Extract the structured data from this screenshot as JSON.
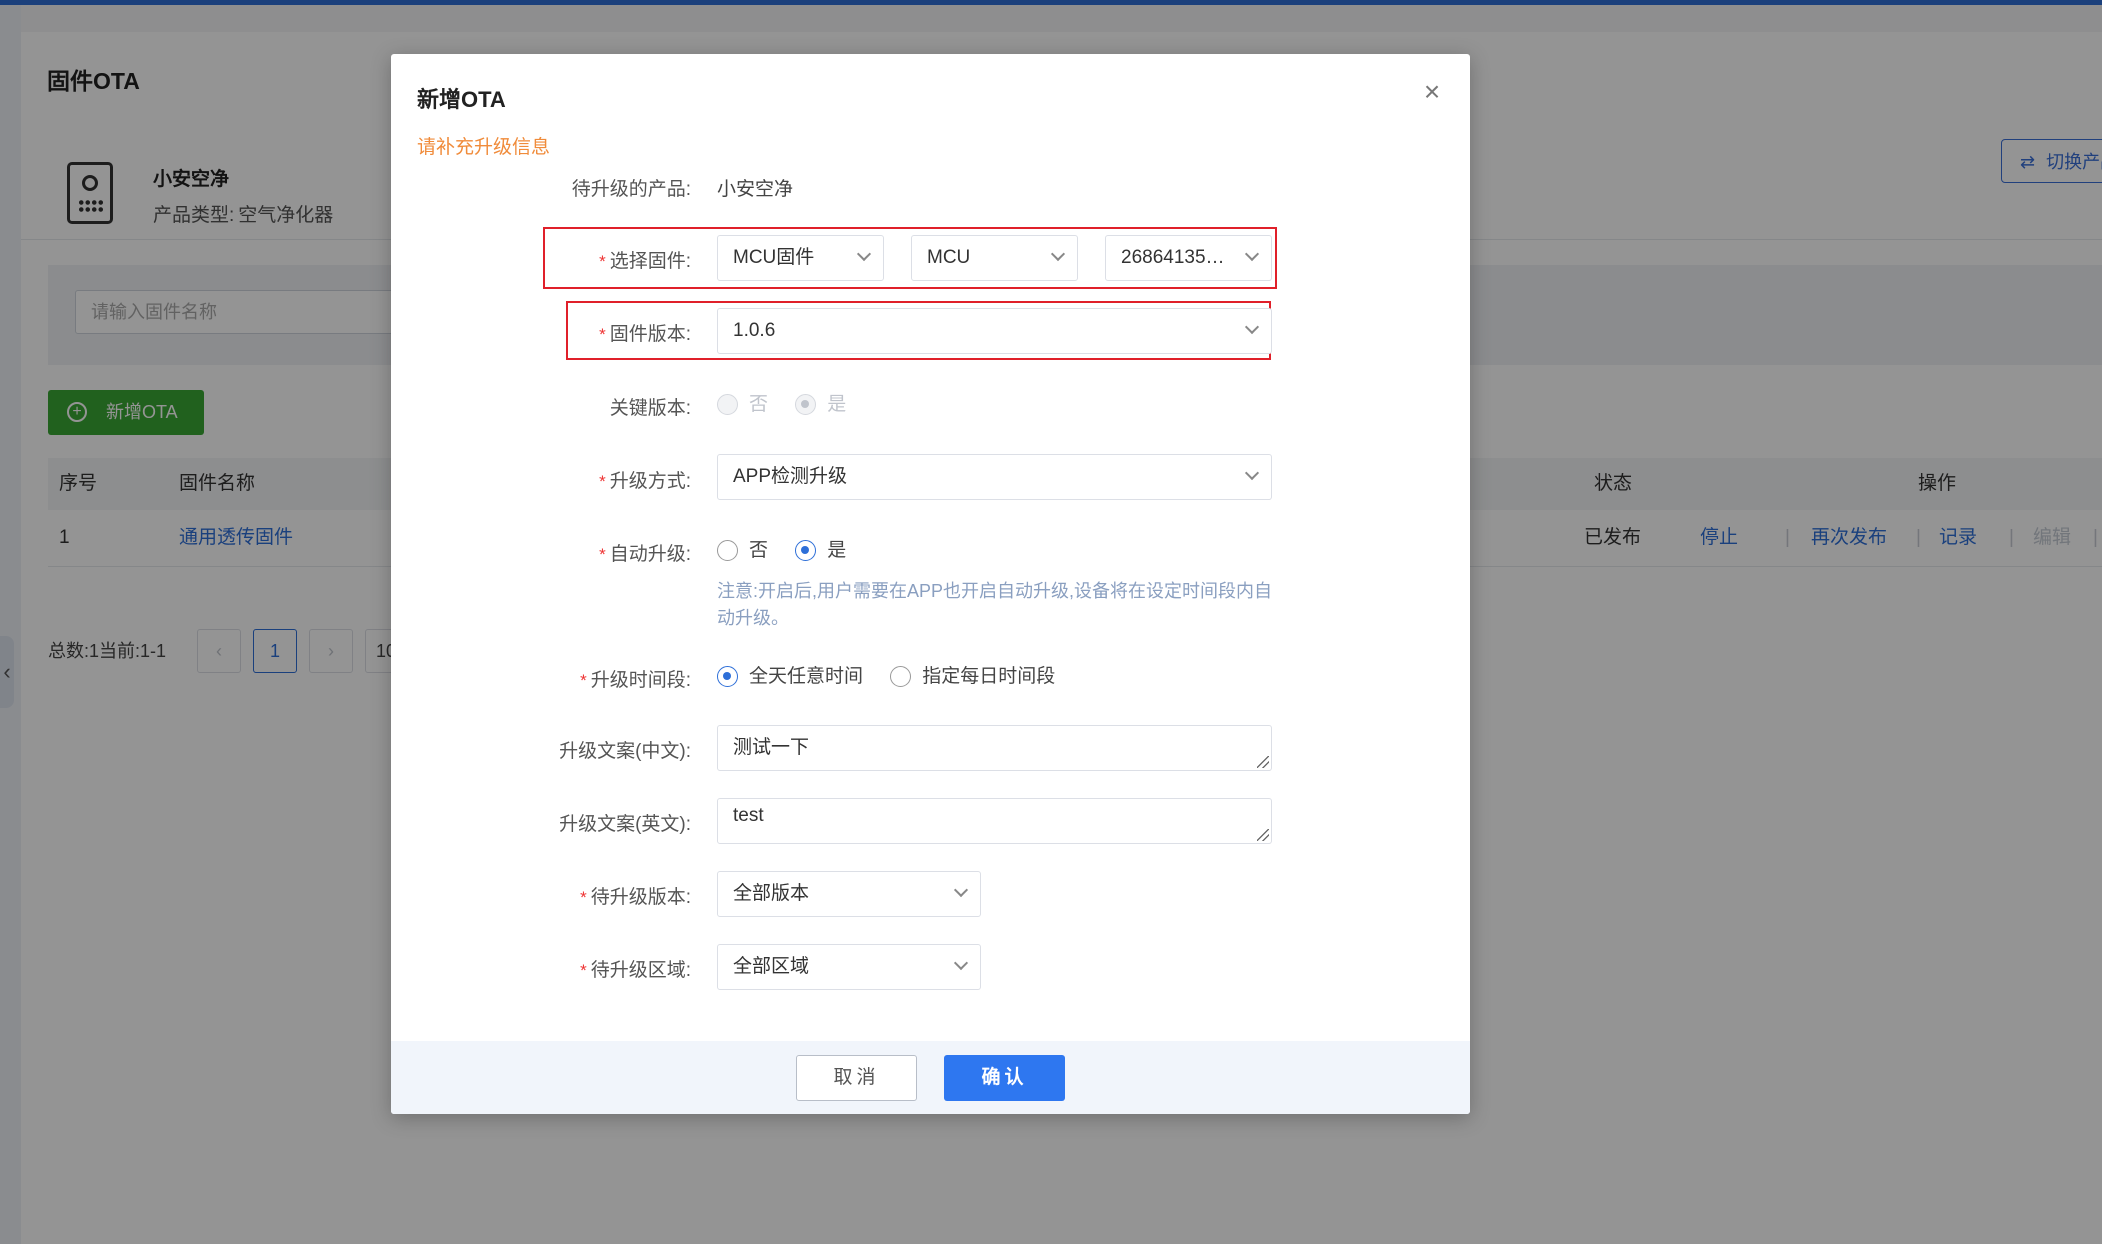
{
  "background": {
    "page_title": "固件OTA",
    "product": {
      "name": "小安空净",
      "type_label": "产品类型:",
      "type_value": "空气净化器"
    },
    "switch_button": "切换产品",
    "search": {
      "placeholder": "请输入固件名称"
    },
    "add_button": "新增OTA",
    "table": {
      "headers": [
        "序号",
        "固件名称",
        "状态",
        "操作"
      ],
      "rows": [
        {
          "index": "1",
          "name": "通用透传固件",
          "status": "已发布",
          "actions": [
            "停止",
            "再次发布",
            "记录",
            "编辑"
          ]
        }
      ]
    },
    "pagination": {
      "total": "总数:1当前:1-1",
      "current_page": "1",
      "page_size": "10"
    }
  },
  "modal": {
    "title": "新增OTA",
    "hint": "请补充升级信息",
    "product_label": "待升级的产品:",
    "product_value": "小安空净",
    "firmware_label": "选择固件:",
    "firmware_type": "MCU固件",
    "firmware_module": "MCU",
    "firmware_id": "268641351...",
    "version_label": "固件版本:",
    "version_value": "1.0.6",
    "key_version_label": "关键版本:",
    "key_version_options": {
      "no": "否",
      "yes": "是"
    },
    "upgrade_method_label": "升级方式:",
    "upgrade_method_value": "APP检测升级",
    "auto_upgrade_label": "自动升级:",
    "auto_upgrade_options": {
      "no": "否",
      "yes": "是"
    },
    "auto_upgrade_note": "注意:开启后,用户需要在APP也开启自动升级,设备将在设定时间段内自动升级。",
    "time_label": "升级时间段:",
    "time_options": {
      "all_day": "全天任意时间",
      "daily": "指定每日时间段"
    },
    "text_cn_label": "升级文案(中文):",
    "text_cn_value": "测试一下",
    "text_en_label": "升级文案(英文):",
    "text_en_value": "test",
    "target_version_label": "待升级版本:",
    "target_version_value": "全部版本",
    "target_region_label": "待升级区域:",
    "target_region_value": "全部区域",
    "cancel_button": "取消",
    "confirm_button": "确认"
  },
  "colors": {
    "primary": "#2e77f0",
    "success": "#3aa835",
    "warning": "#f08b3a",
    "required": "#e33333",
    "highlight": "#e0202a"
  }
}
